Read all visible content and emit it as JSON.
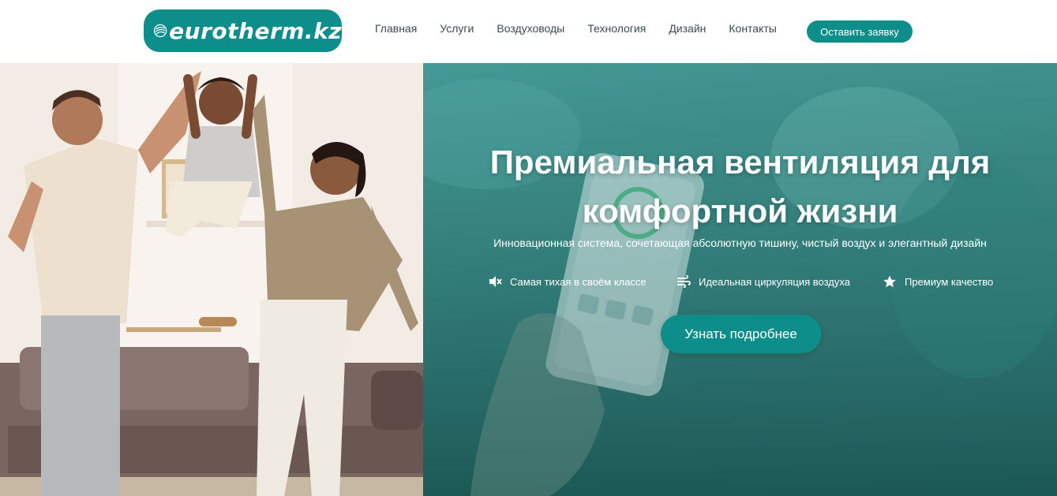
{
  "header": {
    "logo_text": "eurotherm.kz",
    "nav": [
      {
        "label": "Главная"
      },
      {
        "label": "Услуги"
      },
      {
        "label": "Воздуховоды"
      },
      {
        "label": "Технология"
      },
      {
        "label": "Дизайн"
      },
      {
        "label": "Контакты"
      }
    ],
    "cta_label": "Оставить заявку"
  },
  "hero": {
    "title_line1": "Премиальная вентиляция для",
    "title_line2": "комфортной жизни",
    "subtitle": "Инновационная система, сочетающая абсолютную тишину, чистый воздух и элегантный дизайн",
    "features": [
      {
        "icon": "mute-speaker-icon",
        "label": "Самая тихая в своём классе"
      },
      {
        "icon": "wind-icon",
        "label": "Идеальная циркуляция воздуха"
      },
      {
        "icon": "star-icon",
        "label": "Премиум качество"
      }
    ],
    "cta_label": "Узнать подробнее"
  },
  "colors": {
    "brand": "#0e8e8a",
    "overlay": "#2a7470",
    "white": "#ffffff"
  }
}
